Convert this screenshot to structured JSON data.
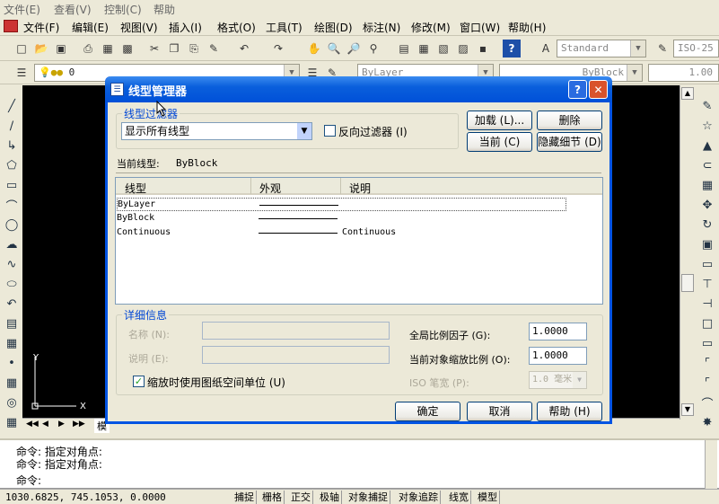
{
  "topmenu": {
    "items": [
      "文件(E)",
      "查看(V)",
      "控制(C)",
      "帮助"
    ]
  },
  "appmenu": {
    "items": [
      "文件(F)",
      "编辑(E)",
      "视图(V)",
      "插入(I)",
      "格式(O)",
      "工具(T)",
      "绘图(D)",
      "标注(N)",
      "修改(M)",
      "窗口(W)",
      "帮助(H)"
    ]
  },
  "toolbar": {
    "text_style": "Standard",
    "dim_style": "ISO-25",
    "layer_value": "0",
    "color_value": "ByLayer",
    "linetype_value": "ByBlock",
    "lineweight_value": "1.00"
  },
  "dialog": {
    "title": "线型管理器",
    "filter_group_label": "线型过滤器",
    "filter_select_value": "显示所有线型",
    "invert_filter_label": "反向过滤器 (I)",
    "load_button": "加载 (L)...",
    "delete_button": "删除",
    "current_button": "当前 (C)",
    "hide_details_button": "隐藏细节 (D)",
    "current_linetype_label": "当前线型:",
    "current_linetype_value": "ByBlock",
    "table": {
      "headers": [
        "线型",
        "外观",
        "说明"
      ],
      "rows": [
        {
          "name": "ByLayer",
          "description": ""
        },
        {
          "name": "ByBlock",
          "description": ""
        },
        {
          "name": "Continuous",
          "description": "Continuous"
        }
      ]
    },
    "details_group_label": "详细信息",
    "name_label": "名称 (N):",
    "desc_label": "说明 (E):",
    "global_scale_label": "全局比例因子 (G):",
    "global_scale_value": "1.0000",
    "current_scale_label": "当前对象缩放比例 (O):",
    "current_scale_value": "1.0000",
    "iso_pen_label": "ISO 笔宽 (P):",
    "iso_pen_value": "1.0 毫米",
    "paper_space_label": "缩放时使用图纸空间单位 (U)",
    "ok_button": "确定",
    "cancel_button": "取消",
    "help_button": "帮助 (H)"
  },
  "drawing": {
    "ucs_x": "X",
    "ucs_y": "Y",
    "tab_label": "模"
  },
  "command": {
    "lines": [
      "命令: 指定对角点:",
      "命令: 指定对角点:",
      "命令:"
    ]
  },
  "status": {
    "coords": "1030.6825, 745.1053, 0.0000",
    "toggles": [
      "捕捉",
      "栅格",
      "正交",
      "极轴",
      "对象捕捉",
      "对象追踪",
      "线宽",
      "模型"
    ]
  },
  "colors": {
    "title_blue": "#0a5fdc",
    "group_label_blue": "#0046d5",
    "canvas": "#000000"
  }
}
